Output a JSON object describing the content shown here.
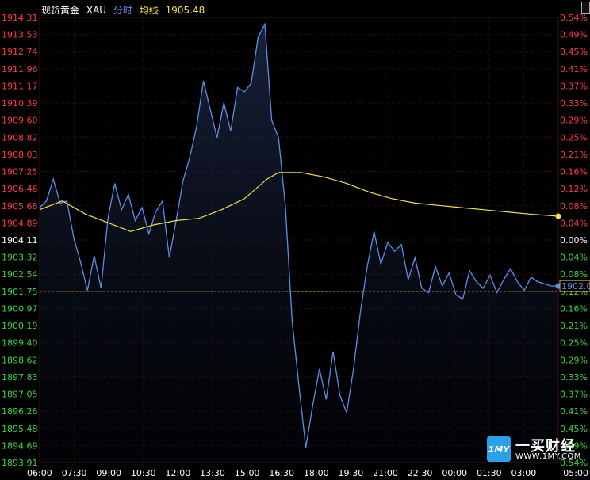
{
  "header": {
    "name": "现货黄金",
    "code": "XAU",
    "mode": "分时",
    "avg_label": "均线",
    "avg_value": "1905.48"
  },
  "last_price_tag": "1902.0",
  "watermark": {
    "cn": "一买财经",
    "url": "WWW.1MY.COM",
    "icon_text": "1MY"
  },
  "colors": {
    "up": "#ff3b3b",
    "down": "#3cd23c",
    "price_line": "#5b8fe6",
    "avg_line": "#f2e14a",
    "grid": "#3a1414",
    "ref_line": "#e8a33a"
  },
  "chart_data": {
    "type": "line",
    "title": "",
    "x_ticks": [
      "06:00",
      "07:30",
      "09:00",
      "10:30",
      "12:00",
      "13:30",
      "15:00",
      "16:30",
      "18:00",
      "19:30",
      "21:00",
      "22:30",
      "00:00",
      "01:30",
      "03:00",
      "05:00"
    ],
    "y_ticks_left": [
      "1914.31",
      "1913.53",
      "1912.74",
      "1911.96",
      "1911.17",
      "1910.39",
      "1909.60",
      "1908.82",
      "1908.03",
      "1907.25",
      "1906.46",
      "1905.68",
      "1904.89",
      "1904.11",
      "1903.32",
      "1902.54",
      "1901.75",
      "1900.97",
      "1900.19",
      "1899.40",
      "1898.62",
      "1897.83",
      "1897.05",
      "1896.26",
      "1895.48",
      "1894.69",
      "1893.91"
    ],
    "y_ticks_right": [
      "0.54%",
      "0.49%",
      "0.45%",
      "0.41%",
      "0.37%",
      "0.33%",
      "0.29%",
      "0.25%",
      "0.21%",
      "0.16%",
      "0.12%",
      "0.08%",
      "0.04%",
      "0.00%",
      "0.04%",
      "0.08%",
      "0.12%",
      "0.16%",
      "0.21%",
      "0.25%",
      "0.29%",
      "0.33%",
      "0.37%",
      "0.41%",
      "0.45%",
      "0.49%",
      "0.54%"
    ],
    "ylim": [
      1893.91,
      1914.31
    ],
    "reference_close": 1901.75,
    "series": [
      {
        "x": [
          0,
          0.3,
          0.6,
          0.9,
          1.2,
          1.5,
          1.8,
          2.1,
          2.4,
          2.7,
          3.0,
          3.3,
          3.6,
          3.9,
          4.2,
          4.5,
          4.8,
          5.1,
          5.4,
          5.7,
          6.0,
          6.3,
          6.6,
          6.9,
          7.2,
          7.5,
          7.8,
          8.1,
          8.4,
          8.7,
          9.0,
          9.3,
          9.6,
          9.9,
          10.2,
          10.5,
          10.8,
          11.1,
          11.4,
          11.7,
          12.0,
          12.3,
          12.6,
          12.9,
          13.2,
          13.5,
          13.8,
          14.1,
          14.4,
          14.7,
          15.0,
          15.3,
          15.6,
          15.9,
          16.2,
          16.5,
          16.8,
          17.1,
          17.4,
          17.7,
          18.0,
          18.3,
          18.6,
          18.9,
          19.2,
          19.5,
          19.8,
          20.1,
          20.4,
          20.7,
          21.0,
          21.3,
          21.6,
          21.9,
          22.2,
          22.5,
          22.8
        ],
        "values": [
          1905.6,
          1905.9,
          1906.9,
          1905.8,
          1905.9,
          1904.2,
          1903.1,
          1901.8,
          1903.4,
          1901.9,
          1905.1,
          1906.7,
          1905.5,
          1906.2,
          1905.0,
          1905.6,
          1904.4,
          1905.4,
          1905.9,
          1903.3,
          1905.0,
          1906.8,
          1907.9,
          1909.3,
          1911.4,
          1910.1,
          1908.8,
          1910.4,
          1909.1,
          1911.1,
          1910.9,
          1911.3,
          1913.4,
          1914.0,
          1909.6,
          1908.8,
          1905.7,
          1900.4,
          1897.4,
          1894.6,
          1896.5,
          1898.2,
          1896.8,
          1899.0,
          1897.0,
          1896.2,
          1898.2,
          1900.8,
          1902.9,
          1904.5,
          1903.0,
          1904.0,
          1903.6,
          1903.9,
          1902.3,
          1903.3,
          1901.9,
          1901.7,
          1902.9,
          1902.0,
          1902.6,
          1901.6,
          1901.4,
          1902.7,
          1902.2,
          1901.9,
          1902.5,
          1901.7,
          1902.3,
          1902.8,
          1902.2,
          1901.8,
          1902.4,
          1902.2,
          1902.1,
          1902.0,
          1902.0
        ],
        "name": ""
      },
      {
        "x": [
          0,
          1.0,
          2.0,
          3.0,
          4.0,
          5.0,
          6.0,
          7.0,
          8.0,
          9.0,
          10.0,
          10.5,
          11.5,
          12.5,
          13.5,
          14.5,
          15.5,
          16.5,
          17.5,
          18.5,
          19.5,
          20.5,
          21.5,
          22.8
        ],
        "values": [
          1905.5,
          1905.9,
          1905.3,
          1904.9,
          1904.5,
          1904.8,
          1905.0,
          1905.1,
          1905.5,
          1906.0,
          1906.9,
          1907.2,
          1907.2,
          1907.0,
          1906.7,
          1906.3,
          1906.0,
          1905.8,
          1905.7,
          1905.6,
          1905.5,
          1905.4,
          1905.3,
          1905.2
        ],
        "name": ""
      }
    ],
    "x_range": [
      0,
      22.8
    ],
    "grid": true
  }
}
